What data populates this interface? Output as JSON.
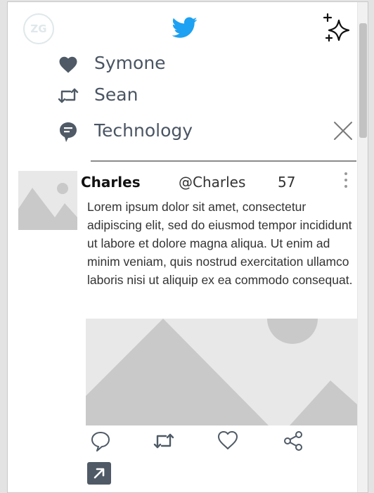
{
  "profile": {
    "avatar_text": "ZG"
  },
  "header": {
    "logo_icon": "twitter-bird-icon",
    "sparkle_icon": "sparkles-icon"
  },
  "rows": [
    {
      "icon": "heart-icon",
      "label": "Symone"
    },
    {
      "icon": "retweet-icon",
      "label": "Sean"
    },
    {
      "icon": "speech-bubble-icon",
      "label": "Technology"
    }
  ],
  "post": {
    "author": "Charles",
    "handle": "@Charles",
    "count": "57",
    "text": "Lorem ipsum dolor sit amet, consectetur adipiscing elit, sed do eiusmod tempor incididunt ut labore et dolore magna aliqua. Ut enim ad minim veniam, quis nostrud exercitation ullamco laboris nisi ut aliquip ex ea commodo consequat."
  },
  "colors": {
    "twitter_blue": "#1da1f2",
    "icon_slate": "#4f5a66",
    "placeholder_bg": "#e8e8e8",
    "placeholder_shape": "#c9c9c9"
  }
}
